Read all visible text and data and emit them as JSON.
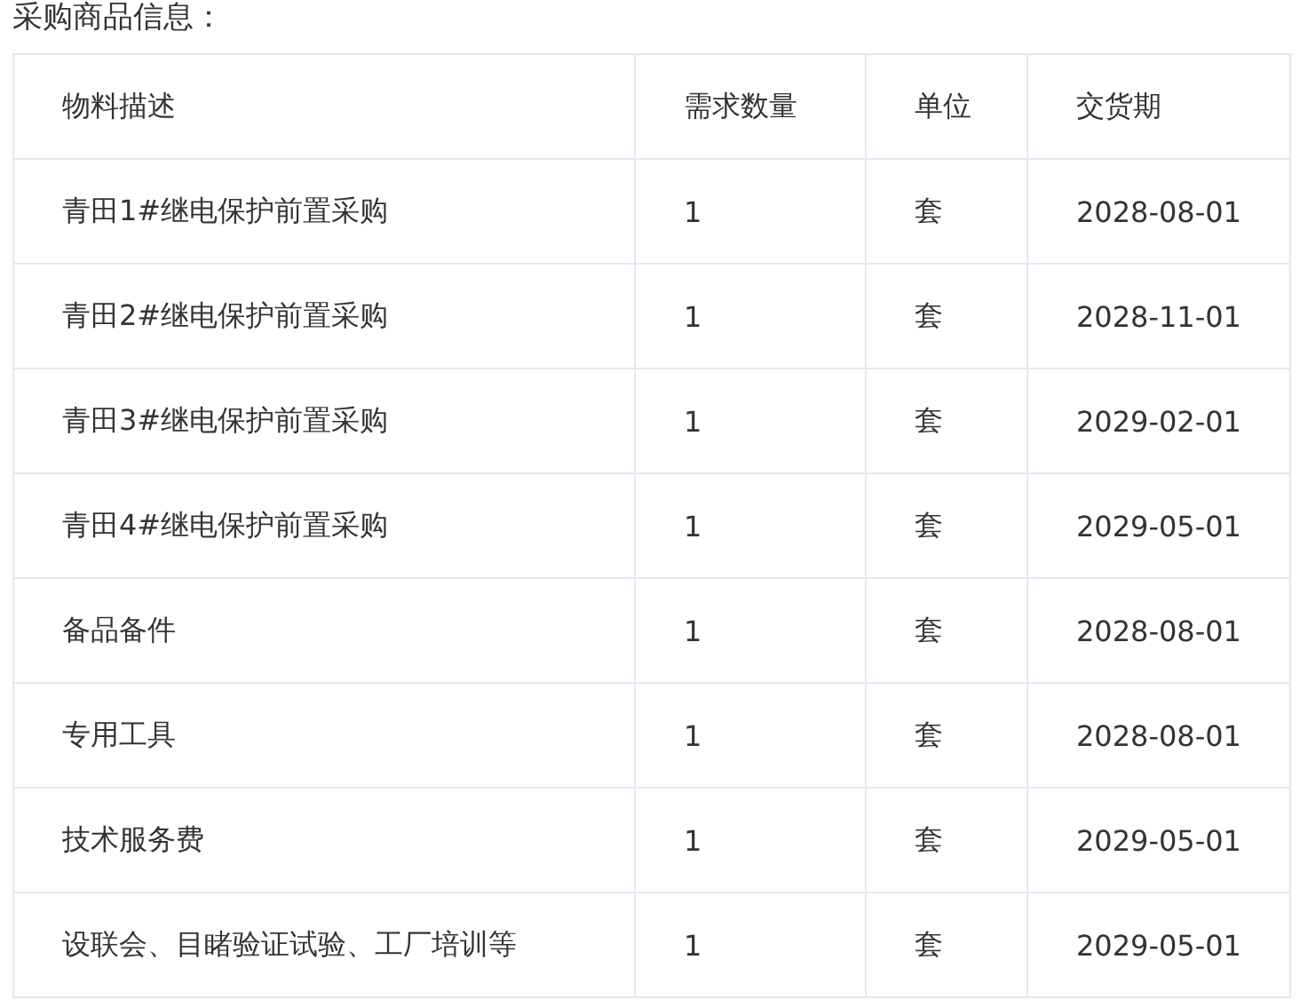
{
  "section_title": "采购商品信息：",
  "table": {
    "columns": [
      "物料描述",
      "需求数量",
      "单位",
      "交货期"
    ],
    "rows": [
      [
        "青田1#继电保护前置采购",
        "1",
        "套",
        "2028-08-01"
      ],
      [
        "青田2#继电保护前置采购",
        "1",
        "套",
        "2028-11-01"
      ],
      [
        "青田3#继电保护前置采购",
        "1",
        "套",
        "2029-02-01"
      ],
      [
        "青田4#继电保护前置采购",
        "1",
        "套",
        "2029-05-01"
      ],
      [
        "备品备件",
        "1",
        "套",
        "2028-08-01"
      ],
      [
        "专用工具",
        "1",
        "套",
        "2028-08-01"
      ],
      [
        "技术服务费",
        "1",
        "套",
        "2029-05-01"
      ],
      [
        "设联会、目睹验证试验、工厂培训等",
        "1",
        "套",
        "2029-05-01"
      ]
    ]
  }
}
